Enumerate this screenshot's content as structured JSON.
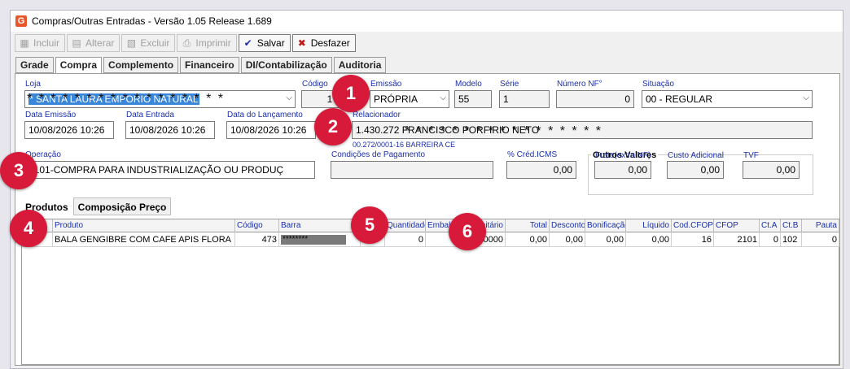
{
  "window": {
    "title": "Compras/Outras Entradas - Versão 1.05 Release 1.689",
    "app_icon": "G"
  },
  "toolbar": {
    "incluir": "Incluir",
    "alterar": "Alterar",
    "excluir": "Excluir",
    "imprimir": "Imprimir",
    "salvar": "Salvar",
    "desfazer": "Desfazer"
  },
  "tabs": [
    "Grade",
    "Compra",
    "Complemento",
    "Financeiro",
    "DI/Contabilização",
    "Auditoria"
  ],
  "form": {
    "loja_label": "Loja",
    "loja_value": "* SANTA LAURA EMPORIO NATURAL",
    "loja_mask": "* * * * * * * * * * * * * * * * *",
    "codigo_label": "Código",
    "codigo_value": "17",
    "emissao_label": "Emissão",
    "emissao_value": "PRÓPRIA",
    "modelo_label": "Modelo",
    "modelo_value": "55",
    "serie_label": "Série",
    "serie_value": "1",
    "numero_label": "Número NF°",
    "numero_value": "0",
    "situacao_label": "Situação",
    "situacao_value": "00 - REGULAR",
    "data_emissao_label": "Data Emissão",
    "data_emissao_value": "10/08/2026 10:26",
    "data_entrada_label": "Data Entrada",
    "data_entrada_value": "10/08/2026 10:26",
    "data_lancamento_label": "Data do Lançamento",
    "data_lancamento_value": "10/08/2026 10:26",
    "relacionador_label": "Relacionador",
    "relacionador_value": "1.430.272 FRANCISCO PORFIRIO NETO",
    "relacionador_mask": "* * * * * * * * * * * * * * * * *",
    "relacionador_sub": "00.272/0001-16   BARREIRA CE",
    "operacao_label": "Operação",
    "operacao_value": "2101-COMPRA PARA INDUSTRIALIZAÇÃO OU PRODUÇ",
    "condicoes_label": "Condições de Pagamento",
    "condicoes_value": "",
    "cred_icms_label": "% Créd.ICMS",
    "cred_icms_value": "0,00",
    "outros_title": "Outros Valores",
    "frete_label": "Frete(extra NF)",
    "frete_value": "0,00",
    "custo_label": "Custo Adicional",
    "custo_value": "0,00",
    "tvf_label": "TVF",
    "tvf_value": "0,00"
  },
  "subtabs": [
    "Produtos",
    "Composição Preço"
  ],
  "grid": {
    "headers": [
      "Item",
      "Produto",
      "Código",
      "Barra",
      "",
      "Quantidade",
      "Embal.",
      "Unitário",
      "Total",
      "Desconto",
      "Bonificação",
      "Líquido",
      "Cod.CFOP",
      "CFOP",
      "Ct.A",
      "Ct.B",
      "Pauta"
    ],
    "rows": [
      {
        "item": "",
        "produto": "BALA GENGIBRE  COM CAFE APIS FLORA",
        "codigo": "473",
        "barra": "********",
        "x": "",
        "quantidade": "0",
        "embal": "",
        "unitario": "0000",
        "total": "0,00",
        "desconto": "0,00",
        "bonificacao": "0,00",
        "liquido": "0,00",
        "codcfop": "16",
        "cfop": "2101",
        "cta": "0",
        "ctb": "102",
        "pauta": "0"
      }
    ]
  },
  "badges": [
    "1",
    "2",
    "3",
    "4",
    "5",
    "6"
  ],
  "colors": {
    "label_blue": "#1a2fa8",
    "badge_red": "#d71a3a",
    "selection_blue": "#3a86d8"
  }
}
